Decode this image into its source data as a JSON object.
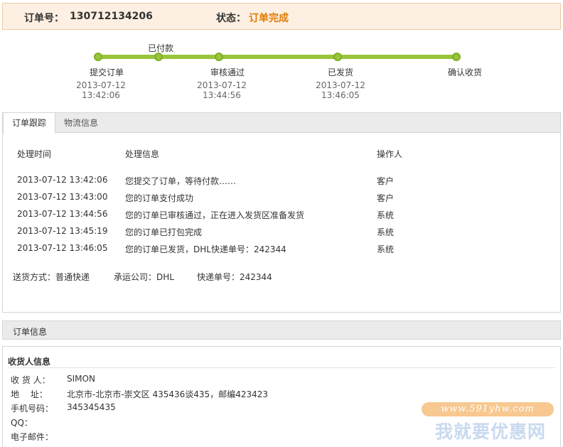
{
  "header": {
    "order_no_label": "订单号：",
    "order_no": "130712134206",
    "status_label": "状态：",
    "status": "订单完成",
    "status_color": "#e07b00"
  },
  "progress": {
    "paid_label": "已付款",
    "steps": [
      {
        "label": "提交订单",
        "time": "2013-07-12 13:42:06"
      },
      {
        "label": "审核通过",
        "time": "2013-07-12 13:44:56"
      },
      {
        "label": "已发货",
        "time": "2013-07-12 13:46:05"
      },
      {
        "label": "确认收货",
        "time": ""
      }
    ],
    "bar_color": "#98c53a"
  },
  "tabs": [
    {
      "label": "订单跟踪",
      "active": true
    },
    {
      "label": "物流信息",
      "active": false
    }
  ],
  "tracking": {
    "columns": [
      "处理时间",
      "处理信息",
      "操作人"
    ],
    "rows": [
      {
        "time": "2013-07-12 13:42:06",
        "info": "您提交了订单，等待付款……",
        "operator": "客户"
      },
      {
        "time": "2013-07-12 13:43:00",
        "info": "您的订单支付成功",
        "operator": "客户"
      },
      {
        "time": "2013-07-12 13:44:56",
        "info": "您的订单已审核通过，正在进入发货区准备发货",
        "operator": "系统"
      },
      {
        "time": "2013-07-12 13:45:19",
        "info": "您的订单已打包完成",
        "operator": "系统"
      },
      {
        "time": "2013-07-12 13:46:05",
        "info": "您的订单已发货，DHL快递单号：242344",
        "operator": "系统"
      }
    ],
    "shipping_method": "送货方式：普通快递",
    "carrier": "承运公司：DHL",
    "tracking_no": "快递单号：242344"
  },
  "order_info": {
    "title": "订单信息"
  },
  "receiver": {
    "title": "收货人信息",
    "fields": [
      {
        "label": "收 货 人：",
        "value": "SIMON"
      },
      {
        "label": "地　 址：",
        "value": "北京市-北京市-崇文区 435436谈435，邮编423423"
      },
      {
        "label": "手机号码：",
        "value": "345345435"
      },
      {
        "label": "QQ：",
        "value": ""
      },
      {
        "label": "电子邮件：",
        "value": ""
      }
    ]
  },
  "watermark": {
    "url": "www.591yhw.com",
    "name": "我就要优惠网"
  }
}
